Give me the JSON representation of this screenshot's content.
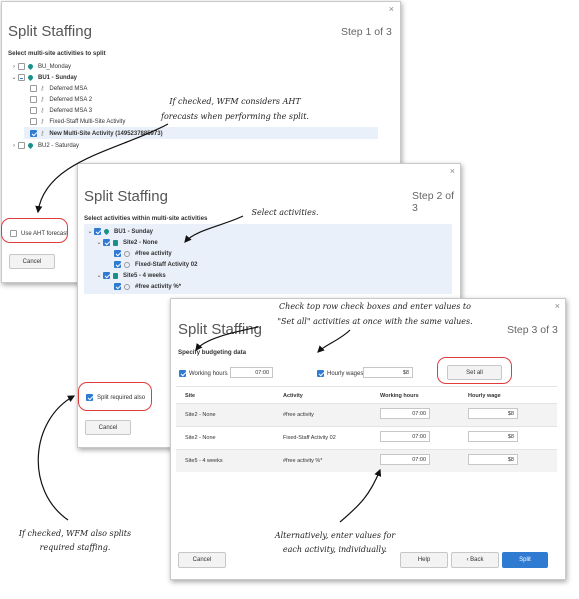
{
  "dialog1": {
    "title": "Split Staffing",
    "step": "Step 1 of 3",
    "close": "×",
    "section_label": "Select multi-site activities to split",
    "tree": [
      "BU_Monday",
      "BU1 - Sunday",
      "Deferred MSA",
      "Deferred MSA 2",
      "Deferred MSA 3",
      "Fixed-Staff Multi-Site Activity",
      "New Multi-Site Activity (1495237885973)",
      "BU2 - Saturday"
    ],
    "aht_label": "Use AHT forecast",
    "cancel": "Cancel"
  },
  "dialog2": {
    "title": "Split Staffing",
    "step": "Step 2 of 3",
    "close": "×",
    "section_label": "Select activities within multi-site activities",
    "tree": [
      "BU1 - Sunday",
      "Site2 - None",
      "#free activity",
      "Fixed-Staff Activity 02",
      "Site5 - 4 weeks",
      "#free activity %*"
    ],
    "split_required_label": "Split required also",
    "cancel": "Cancel"
  },
  "dialog3": {
    "title": "Split Staffing",
    "step": "Step 3 of 3",
    "close": "×",
    "section_label": "Specify budgeting data",
    "working_hours_label": "Working hours",
    "working_hours_value": "07:00",
    "hourly_wages_label": "Hourly wages",
    "hourly_wages_value": "$8",
    "set_all": "Set all",
    "columns": [
      "Site",
      "Activity",
      "Working hours",
      "Hourly wage"
    ],
    "rows": [
      {
        "site": "Site2 - None",
        "activity": "#free activity",
        "hours": "07:00",
        "wage": "$8"
      },
      {
        "site": "Site2 - None",
        "activity": "Fixed-Staff Activity 02",
        "hours": "07:00",
        "wage": "$8"
      },
      {
        "site": "Site5 - 4 weeks",
        "activity": "#free activity %*",
        "hours": "07:00",
        "wage": "$8"
      }
    ],
    "cancel": "Cancel",
    "help": "Help",
    "back": "‹ Back",
    "split": "Split"
  },
  "annotations": {
    "aht_1": "If checked, WFM considers AHT",
    "aht_2": "forecasts when performing the split.",
    "select": "Select activities.",
    "setall_1": "Check top row check boxes and enter values to",
    "setall_2": "\"Set all\" activities at once with the same values.",
    "splitreq_1": "If checked, WFM also splits",
    "splitreq_2": "required staffing.",
    "indiv_1": "Alternatively, enter values for",
    "indiv_2": "each activity, individually."
  },
  "colors": {
    "accent": "#2f7bd2",
    "callout": "#e03c3c",
    "pin": "#1a8f8a",
    "highlight": "#e9f0fa"
  }
}
